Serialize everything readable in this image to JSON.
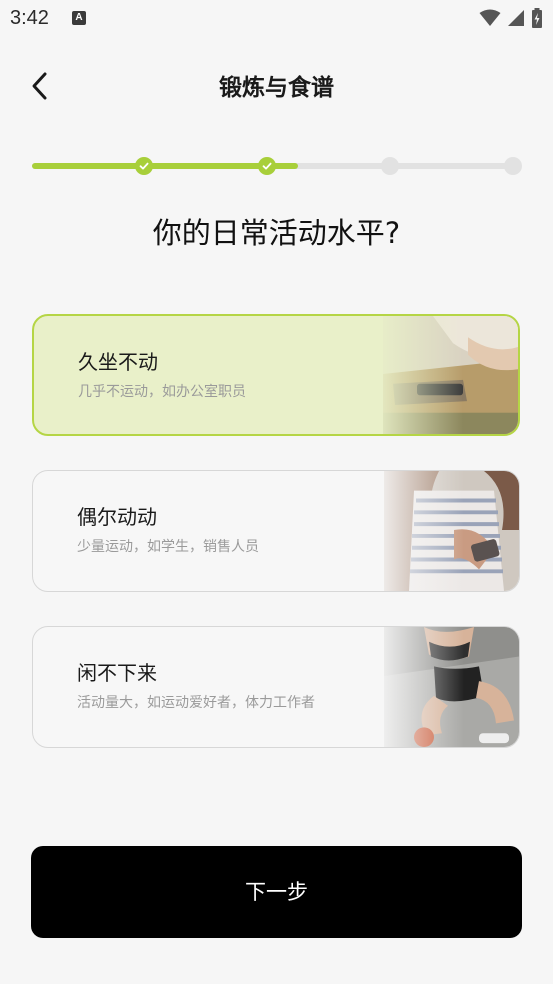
{
  "status_bar": {
    "time": "3:42",
    "notification_letter": "A",
    "icons": [
      "wifi-icon",
      "signal-icon",
      "battery-icon"
    ]
  },
  "header": {
    "back_icon": "chevron-left-icon",
    "title": "锻炼与食谱"
  },
  "progress": {
    "total_steps": 4,
    "completed_steps": 2,
    "accent_color": "#a8cf3a",
    "track_color": "#e2e2e2"
  },
  "question": "你的日常活动水平?",
  "options": [
    {
      "title": "久坐不动",
      "description": "几乎不运动，如办公室职员",
      "selected": true,
      "image": "office-desk-photo"
    },
    {
      "title": "偶尔动动",
      "description": "少量运动，如学生，销售人员",
      "selected": false,
      "image": "woman-with-phone-photo"
    },
    {
      "title": "闲不下来",
      "description": "活动量大，如运动爱好者，体力工作者",
      "selected": false,
      "image": "athlete-sitting-photo"
    }
  ],
  "next_button": {
    "label": "下一步"
  },
  "colors": {
    "selected_background": "#e9f0c9",
    "selected_border": "#b5d545",
    "button_background": "#000000"
  }
}
